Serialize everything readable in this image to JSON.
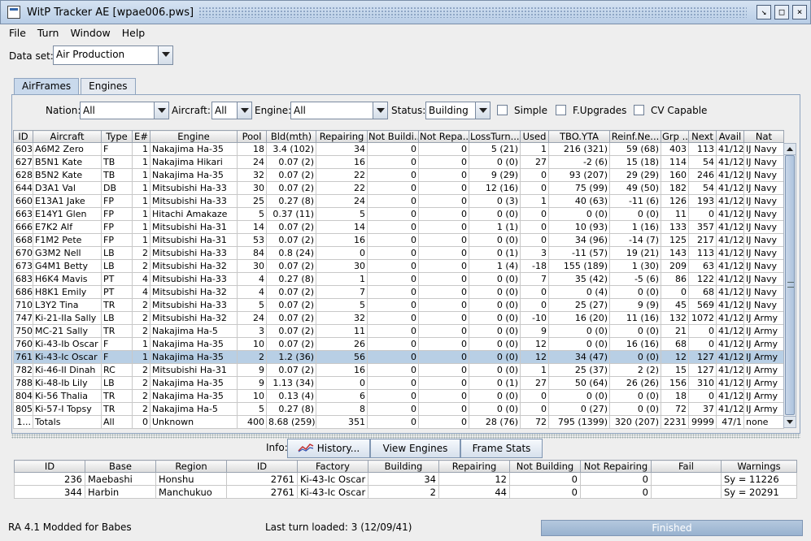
{
  "window": {
    "title": "WitP Tracker AE [wpae006.pws]"
  },
  "menu": [
    "File",
    "Turn",
    "Window",
    "Help"
  ],
  "dataset": {
    "label": "Data set:",
    "value": "Air Production"
  },
  "tabs": [
    "AirFrames",
    "Engines"
  ],
  "filters": {
    "nation_label": "Nation:",
    "nation": "All",
    "aircraft_label": "Aircraft:",
    "aircraft": "All",
    "engine_label": "Engine:",
    "engine": "All",
    "status_label": "Status:",
    "status": "Building",
    "simple": "Simple",
    "fupgrades": "F.Upgrades",
    "cv_capable": "CV Capable"
  },
  "grid": {
    "columns": [
      "ID",
      "Aircraft",
      "Type",
      "E#",
      "Engine",
      "Pool",
      "Bld(mth)",
      "Repairing",
      "Not Buildi...",
      "Not Repa...",
      "LossTurn...",
      "Used",
      "TBO.YTA",
      "Reinf.Ne...",
      "Grp ...",
      "Next",
      "Avail",
      "Nat"
    ],
    "rows": [
      [
        "603",
        "A6M2 Zero",
        "F",
        "1",
        "Nakajima Ha-35",
        "18",
        "3.4 (102)",
        "34",
        "0",
        "0",
        "5 (21)",
        "1",
        "216 (321)",
        "59 (68)",
        "403",
        "113",
        "41/12",
        "IJ Navy"
      ],
      [
        "627",
        "B5N1 Kate",
        "TB",
        "1",
        "Nakajima Hikari",
        "24",
        "0.07 (2)",
        "16",
        "0",
        "0",
        "0 (0)",
        "27",
        "-2 (6)",
        "15 (18)",
        "114",
        "54",
        "41/12",
        "IJ Navy"
      ],
      [
        "628",
        "B5N2 Kate",
        "TB",
        "1",
        "Nakajima Ha-35",
        "32",
        "0.07 (2)",
        "22",
        "0",
        "0",
        "9 (29)",
        "0",
        "93 (207)",
        "29 (29)",
        "160",
        "246",
        "41/12",
        "IJ Navy"
      ],
      [
        "644",
        "D3A1 Val",
        "DB",
        "1",
        "Mitsubishi Ha-33",
        "30",
        "0.07 (2)",
        "22",
        "0",
        "0",
        "12 (16)",
        "0",
        "75 (99)",
        "49 (50)",
        "182",
        "54",
        "41/12",
        "IJ Navy"
      ],
      [
        "660",
        "E13A1 Jake",
        "FP",
        "1",
        "Mitsubishi Ha-33",
        "25",
        "0.27 (8)",
        "24",
        "0",
        "0",
        "0 (3)",
        "1",
        "40 (63)",
        "-11 (6)",
        "126",
        "193",
        "41/12",
        "IJ Navy"
      ],
      [
        "663",
        "E14Y1 Glen",
        "FP",
        "1",
        "Hitachi Amakaze",
        "5",
        "0.37 (11)",
        "5",
        "0",
        "0",
        "0 (0)",
        "0",
        "0 (0)",
        "0 (0)",
        "11",
        "0",
        "41/12",
        "IJ Navy"
      ],
      [
        "666",
        "E7K2 Alf",
        "FP",
        "1",
        "Mitsubishi Ha-31",
        "14",
        "0.07 (2)",
        "14",
        "0",
        "0",
        "1 (1)",
        "0",
        "10 (93)",
        "1 (16)",
        "133",
        "357",
        "41/12",
        "IJ Navy"
      ],
      [
        "668",
        "F1M2 Pete",
        "FP",
        "1",
        "Mitsubishi Ha-31",
        "53",
        "0.07 (2)",
        "16",
        "0",
        "0",
        "0 (0)",
        "0",
        "34 (96)",
        "-14 (7)",
        "125",
        "217",
        "41/12",
        "IJ Navy"
      ],
      [
        "670",
        "G3M2 Nell",
        "LB",
        "2",
        "Mitsubishi Ha-33",
        "84",
        "0.8 (24)",
        "0",
        "0",
        "0",
        "0 (1)",
        "3",
        "-11 (57)",
        "19 (21)",
        "143",
        "113",
        "41/12",
        "IJ Navy"
      ],
      [
        "673",
        "G4M1 Betty",
        "LB",
        "2",
        "Mitsubishi Ha-32",
        "30",
        "0.07 (2)",
        "30",
        "0",
        "0",
        "1 (4)",
        "-18",
        "155 (189)",
        "1 (30)",
        "209",
        "63",
        "41/12",
        "IJ Navy"
      ],
      [
        "683",
        "H6K4 Mavis",
        "PT",
        "4",
        "Mitsubishi Ha-33",
        "4",
        "0.27 (8)",
        "1",
        "0",
        "0",
        "0 (0)",
        "7",
        "35 (42)",
        "-5 (6)",
        "86",
        "122",
        "41/12",
        "IJ Navy"
      ],
      [
        "686",
        "H8K1 Emily",
        "PT",
        "4",
        "Mitsubishi Ha-32",
        "4",
        "0.07 (2)",
        "7",
        "0",
        "0",
        "0 (0)",
        "0",
        "0 (4)",
        "0 (0)",
        "0",
        "68",
        "41/12",
        "IJ Navy"
      ],
      [
        "710",
        "L3Y2 Tina",
        "TR",
        "2",
        "Mitsubishi Ha-33",
        "5",
        "0.07 (2)",
        "5",
        "0",
        "0",
        "0 (0)",
        "0",
        "25 (27)",
        "9 (9)",
        "45",
        "569",
        "41/12",
        "IJ Navy"
      ],
      [
        "747",
        "Ki-21-IIa Sally",
        "LB",
        "2",
        "Mitsubishi Ha-32",
        "24",
        "0.07 (2)",
        "32",
        "0",
        "0",
        "0 (0)",
        "-10",
        "16 (20)",
        "11 (16)",
        "132",
        "1072",
        "41/12",
        "IJ Army"
      ],
      [
        "750",
        "MC-21 Sally",
        "TR",
        "2",
        "Nakajima Ha-5",
        "3",
        "0.07 (2)",
        "11",
        "0",
        "0",
        "0 (0)",
        "9",
        "0 (0)",
        "0 (0)",
        "21",
        "0",
        "41/12",
        "IJ Army"
      ],
      [
        "760",
        "Ki-43-Ib Oscar",
        "F",
        "1",
        "Nakajima Ha-35",
        "10",
        "0.07 (2)",
        "26",
        "0",
        "0",
        "0 (0)",
        "12",
        "0 (0)",
        "16 (16)",
        "68",
        "0",
        "41/12",
        "IJ Army"
      ],
      [
        "761",
        "Ki-43-Ic Oscar",
        "F",
        "1",
        "Nakajima Ha-35",
        "2",
        "1.2 (36)",
        "56",
        "0",
        "0",
        "0 (0)",
        "12",
        "34 (47)",
        "0 (0)",
        "12",
        "127",
        "41/12",
        "IJ Army"
      ],
      [
        "782",
        "Ki-46-II Dinah",
        "RC",
        "2",
        "Mitsubishi Ha-31",
        "9",
        "0.07 (2)",
        "16",
        "0",
        "0",
        "0 (0)",
        "1",
        "25 (37)",
        "2 (2)",
        "15",
        "127",
        "41/12",
        "IJ Army"
      ],
      [
        "788",
        "Ki-48-Ib Lily",
        "LB",
        "2",
        "Nakajima Ha-35",
        "9",
        "1.13 (34)",
        "0",
        "0",
        "0",
        "0 (1)",
        "27",
        "50 (64)",
        "26 (26)",
        "156",
        "310",
        "41/12",
        "IJ Army"
      ],
      [
        "804",
        "Ki-56 Thalia",
        "TR",
        "2",
        "Nakajima Ha-35",
        "10",
        "0.13 (4)",
        "6",
        "0",
        "0",
        "0 (0)",
        "0",
        "0 (0)",
        "0 (0)",
        "18",
        "0",
        "41/12",
        "IJ Army"
      ],
      [
        "805",
        "Ki-57-I Topsy",
        "TR",
        "2",
        "Nakajima Ha-5",
        "5",
        "0.27 (8)",
        "8",
        "0",
        "0",
        "0 (0)",
        "0",
        "0 (27)",
        "0 (0)",
        "72",
        "37",
        "41/12",
        "IJ Army"
      ]
    ],
    "totals": [
      "1...",
      "Totals",
      "All",
      "0",
      "Unknown",
      "400",
      "8.68 (259)",
      "351",
      "0",
      "0",
      "28 (76)",
      "72",
      "795 (1399)",
      "320 (207)",
      "2231",
      "9999",
      "47/1",
      "none"
    ]
  },
  "info": {
    "label": "Info:",
    "history": "History...",
    "view_engines": "View Engines",
    "frame_stats": "Frame Stats"
  },
  "factories": {
    "columns": [
      "ID",
      "Base",
      "Region",
      "ID",
      "Factory",
      "Building",
      "Repairing",
      "Not Building",
      "Not Repairing",
      "Fail",
      "Warnings"
    ],
    "rows": [
      [
        "236",
        "Maebashi",
        "Honshu",
        "2761",
        "Ki-43-Ic Oscar",
        "34",
        "12",
        "0",
        "0",
        "",
        "Sy = 11226"
      ],
      [
        "344",
        "Harbin",
        "Manchukuo",
        "2761",
        "Ki-43-Ic Oscar",
        "2",
        "44",
        "0",
        "0",
        "",
        "Sy = 20291"
      ]
    ]
  },
  "status": {
    "left": "RA 4.1 Modded for Babes",
    "center": "Last turn loaded: 3 (12/09/41)",
    "progress_text": "Finished",
    "progress_percent": 100
  },
  "colors": {
    "selection": "#b8cfe5",
    "progress": "#a4bcd6"
  }
}
